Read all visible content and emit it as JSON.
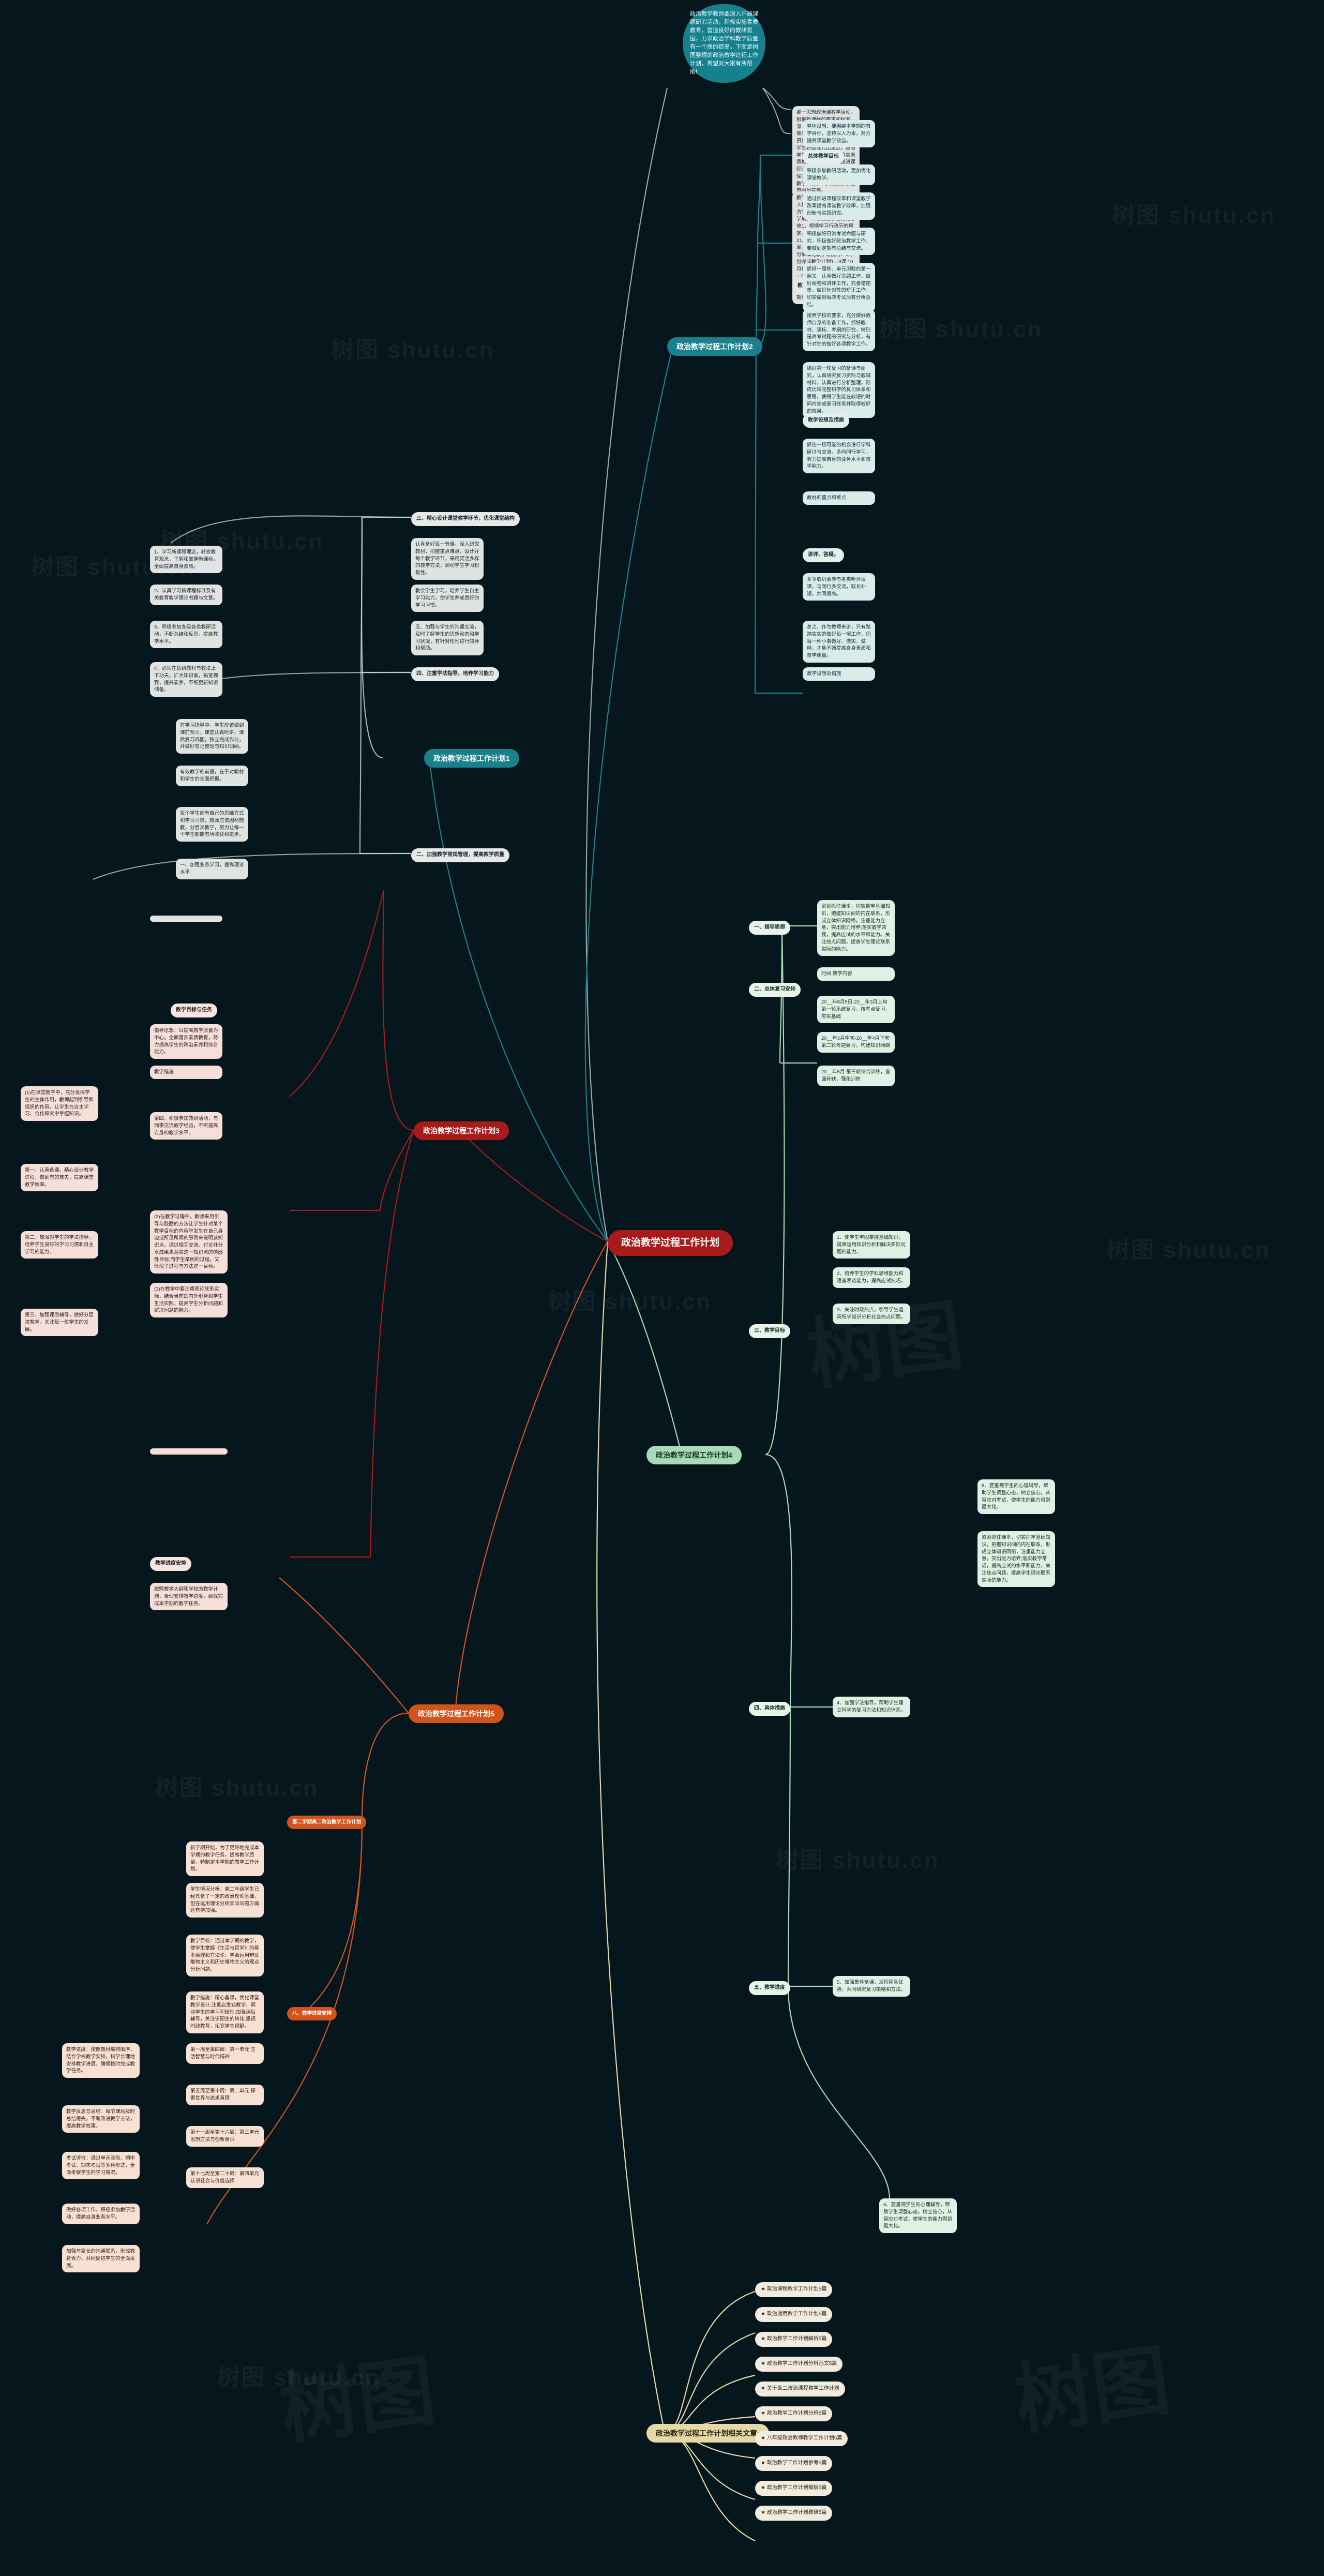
{
  "meta": {
    "watermark": "树图 shutu.cn",
    "bg": "#06161d",
    "accent_red": "#a81b1b",
    "accent_teal": "#19808c",
    "accent_green": "#a9d9b6",
    "accent_orange": "#d2541c",
    "accent_sand": "#e6d9a8"
  },
  "root": {
    "label": "政治教学过程工作计划"
  },
  "intro": {
    "text": "政治教学教师要深入开展课题研究活动，积极实施素质教育，营造良好的教研氛围，力求政治学科教学质量有一个质的提高。下面是树图整理的政治教学过程工作计划，希望对大家有所帮助!"
  },
  "branches": [
    {
      "id": "b2",
      "label": "政治教学过程工作计划2",
      "style": "b-teal"
    },
    {
      "id": "b1",
      "label": "政治教学过程工作计划1",
      "style": "b-teal"
    },
    {
      "id": "b3",
      "label": "政治教学过程工作计划3",
      "style": "b-red"
    },
    {
      "id": "b4",
      "label": "政治教学过程工作计划4",
      "style": "b-green"
    },
    {
      "id": "b5",
      "label": "政治教学过程工作计划5",
      "style": "b-orange"
    },
    {
      "id": "bref",
      "label": "政治教学过程工作计划相关文章:",
      "style": "b-sand"
    }
  ],
  "intro_children": [
    {
      "text": "高一思想政治课教学活动，根据新课标的要求和标准，深入学习教学大纲及考纲，做到教学要有针对性，积极贯彻党的教育方针，以调动学生积极性为出发点，提高学生学习效率，全面落实素质教育为目标，积极推进课程改革和课堂教学改革，确保完成本学期的教学任务和教学目标，以其使教学质量有明显提高。"
    },
    {
      "text": "教学内容是第一项使用的是人教版思想政治必修1《经济生活》。高一政治在第一学期，本学期教学任务为必修1，根据学习行政历的规定，本学期高一政治教学周21周，其中教学时间19周，复习两周的工作计划，分解细化教学进度为：9月份完成教学计划1—3课;10月份完成积极哦啊小计划4—6课;期中考试完成后，11月份完成7—8课;12月份完成9—11课;元月份复习进行期终考试。"
    }
  ],
  "b2_sections": [
    {
      "head": "总体教学目标"
    },
    {
      "head": "教学设想及措施"
    },
    {
      "head": "教材的重点和难点"
    }
  ],
  "b2_cards": [
    {
      "text": "教学设想及措施"
    },
    {
      "text": "整体设想：要围绕本学期的教学目标，坚持以人为本，努力提高课堂教学效益。"
    },
    {
      "text": "积极参加教研活动，更加优化课堂教学。"
    },
    {
      "text": "通过推进课程改革和课堂教学改革提高课堂教学效率，加强创新与实践研究。"
    },
    {
      "text": "积极做好日常考试命题与研究，积极做好政治教学工作，要做到定期有总结与交流。"
    },
    {
      "text": "抓好一周练、单元测验的第一遍关，认真做好命题工作，做好阅卷和讲评工作，完善错题集，做好针对性的矫正工作，切实做到每次考试后有分析总结。"
    },
    {
      "text": "按照学校的要求，充分做好教师自身的准备工作，抓好教材、课标、考纲的研究，特别是高考试题的研究与分析，有针对性的做好各项教学工作。"
    },
    {
      "text": "搞好第一轮复习的备课与研究，认真研究复习资料与教辅材料，认真进行分析整理，形成比较完整科学的复习体系和思路，使得学生能在较短的时间内完成复习任务并取得较好的效果。"
    },
    {
      "text": "抓住一切可能的机会进行学科研讨与交流，多向同行学习，努力提高自身的业务水平和教学能力。"
    },
    {
      "text": "教材的重点和难点"
    },
    {
      "text": "讲评、答疑。"
    },
    {
      "text": "多争取机会参与各类听评议课，与同行多交流，取长补短，共同提高。"
    },
    {
      "text": "总之，作为教师来讲，只有踏踏实实的做好每一项工作，把每一件小事做好、做实、做精，才能不断提高自身素质和教学质量。"
    }
  ],
  "b1_cards": [
    {
      "text": "一、加强业务学习，提高理论水平"
    },
    {
      "text": "1、学习新课程理念，转变教育观念，了解和掌握新课标，全面提高自身素质。"
    },
    {
      "text": "2、认真学习新课程标准及有关教育教学理论书籍与文章。"
    },
    {
      "text": "3、积极参加各级各类教研活动，不断总结和反思，提高教学水平。"
    },
    {
      "text": "4、必须在钻研教材与教法上下功夫，扩大知识面，拓宽视野，提升素养，不断更新知识储备。"
    },
    {
      "text": "二、加强教学常规管理，提高教学质量"
    },
    {
      "text": "在学习指导中，学生应该做到课前预习，课堂认真听讲，课后复习巩固，独立完成作业，并做好笔记整理与知识归纳。"
    },
    {
      "text": "有效教学的前提，在于对教材和学生的全面把握。"
    },
    {
      "text": "每个学生都有自己的思维方式和学习习惯，教师应该因材施教，分层次教学，努力让每一个学生都能有所收获和进步。"
    },
    {
      "text": "三、精心设计课堂教学环节，优化课堂结构"
    },
    {
      "text": "认真备好每一节课，深入研究教材，把握重点难点，设计好每个教学环节，采用灵活多样的教学方法，调动学生学习积极性。"
    },
    {
      "text": "四、注重学法指导，培养学习能力"
    },
    {
      "text": "教会学生学习，培养学生自主学习能力，使学生养成良好的学习习惯。"
    },
    {
      "text": "五、加强与学生的沟通交流，及时了解学生的思想动态和学习状况，有针对性地进行辅导和帮助。"
    }
  ],
  "b3_cards": [
    {
      "text": "指导思想：以提高教学质量为中心，全面落实素质教育，努力提高学生的政治素养和综合能力。"
    },
    {
      "text": "教学目标与任务"
    },
    {
      "text": "(1)在课堂教学中，充分发挥学生的主体作用，教师起到引导和组织的作用，让学生在自主学习、合作探究中掌握知识。"
    },
    {
      "text": "(2)在教学过程中，教师采用引导与鼓励的方法让学生针对某个教学目标的内容举发生在自己身边或所见所闻的事例来说明该知识点，通过相互交流、讨论并分享成果来落实这一知识点的情感性目标;而学生举例的过程，又体现了过程与方法这一目标。"
    },
    {
      "text": "(3)在教学中要注重理论联系实际，结合当前国内外形势和学生生活实际，提高学生分析问题和解决问题的能力。"
    },
    {
      "text": "教学措施"
    },
    {
      "text": "第一、认真备课，精心设计教学过程，做到有的放矢，提高课堂教学效率。"
    },
    {
      "text": "第二、加强对学生的学法指导，培养学生良好的学习习惯和自主学习的能力。"
    },
    {
      "text": "第三、加强课后辅导，做好分层次教学，关注每一位学生的发展。"
    },
    {
      "text": "第四、积极参加教研活动，与同事交流教学经验，不断提高自身的教学水平。"
    },
    {
      "text": "教学进度安排"
    },
    {
      "text": "按照教学大纲和学校的教学计划，合理安排教学进度，确保完成本学期的教学任务。"
    }
  ],
  "b4_cards": [
    {
      "head": "一、指导思想"
    },
    {
      "head": "二、总体复习安排"
    },
    {
      "head": "三、教学目标"
    },
    {
      "head": "四、具体措施"
    },
    {
      "head": "五、教学进度"
    },
    {
      "text": "紧紧抓住课本，切实抓牢基础知识，把握知识间的内在联系，形成立体知识网络，注重能力立意，突出能力培养;落实教学常规，提高应试的水平和能力。关注热点问题，提高学生理论联系实际的能力。"
    },
    {
      "text": "时间 教学内容"
    },
    {
      "text": "20__年8月5日-20__年3月上旬 第一轮系统复习，按考点复习，夯实基础"
    },
    {
      "text": "20__年3月中旬-20__年4月下旬 第二轮专题复习，构建知识网络"
    },
    {
      "text": "20__年5月 第三轮综合训练，查漏补缺，强化训练"
    },
    {
      "text": "1、使学生牢固掌握基础知识，提高运用知识分析和解决实际问题的能力。"
    },
    {
      "text": "2、培养学生的学科思维能力和语言表达能力，提高应试技巧。"
    },
    {
      "text": "3、关注时政热点，引导学生运用所学知识分析社会热点问题。"
    },
    {
      "text": "4、加强学法指导，帮助学生建立科学的复习方法和知识体系。"
    },
    {
      "text": "5、加强集体备课，发挥团队优势，共同研究复习策略和方法。"
    },
    {
      "text": "6、要重视学生的心理辅导，帮助学生调整心态，树立信心，从容应对考试，使学生的能力得到最大化。"
    }
  ],
  "b5_cards": [
    {
      "text": "第二学期高二政治教学工作计划"
    },
    {
      "text": "新学期开始，为了更好地完成本学期的教学任务，提高教学质量，特制定本学期的教学工作计划。"
    },
    {
      "text": "学生情况分析：高二年级学生已经具备了一定的政治理论基础，但在运用理论分析实际问题方面还有待加强。"
    },
    {
      "text": "教学目标：通过本学期的教学，使学生掌握《生活与哲学》的基本原理和方法论，学会运用辩证唯物主义和历史唯物主义的观点分析问题。"
    },
    {
      "text": "教学措施：精心备课，优化课堂教学设计;注重启发式教学，调动学生的学习积极性;加强课后辅导，关注学困生的转化;重视时政教育，拓宽学生视野。"
    },
    {
      "text": "教学进度：按照教材编排顺序，结合学校教学安排，科学合理地安排教学进度，确保按时完成教学任务。"
    },
    {
      "text": "教学反思与总结：每节课后及时总结得失，不断改进教学方法，提高教学效果。"
    },
    {
      "text": "八、教学进度安排"
    },
    {
      "text": "第一周至第四周：第一单元 生活智慧与时代精神"
    },
    {
      "text": "第五周至第十周：第二单元 探索世界与追求真理"
    },
    {
      "text": "第十一周至第十六周：第三单元 思想方法与创新意识"
    },
    {
      "text": "第十七周至第二十周：第四单元 认识社会与价值选择"
    },
    {
      "text": "考试评价：通过单元测验、期中考试、期末考试等多种形式，全面考察学生的学习情况。"
    },
    {
      "text": "做好各项工作，积极参加教研活动，提高自身业务水平。"
    },
    {
      "text": "加强与家长的沟通联系，形成教育合力，共同促进学生的全面发展。"
    }
  ],
  "related_articles": [
    "政治课程教学工作计划5篇",
    "政治通用教学工作计划5篇",
    "政治教学工作计划解析5篇",
    "政治教学工作计划分析范文5篇",
    "关于高二政治课程教学工作计划",
    "政治教学工作计划分析5篇",
    "八年级政治教师教学工作计划5篇",
    "政治教学工作计划参考5篇",
    "政治教学工作计划模板5篇",
    "政治教学工作计划教研5篇"
  ]
}
